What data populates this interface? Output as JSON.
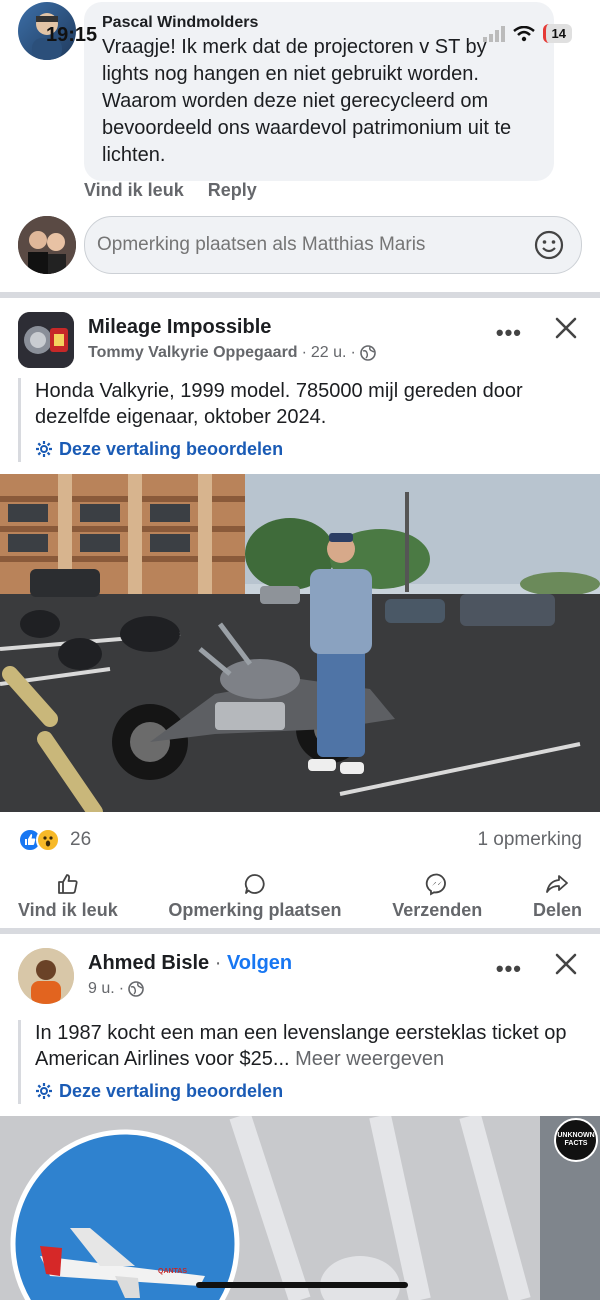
{
  "status_bar": {
    "time": "19:15",
    "battery": "14"
  },
  "comment": {
    "author": "Pascal Windmolders",
    "text": "Vraagje!  Ik merk dat de projectoren v ST by lights nog hangen en niet gebruikt worden. Waarom worden deze niet gerecycleerd om bevoordeeld ons waardevol patrimonium uit te lichten.",
    "like_label": "Vind ik leuk",
    "reply_label": "Reply"
  },
  "reply_box": {
    "placeholder": "Opmerking plaatsen als Matthias Maris"
  },
  "post1": {
    "group": "Mileage Impossible",
    "author": "Tommy Valkyrie Oppegaard",
    "time": "22 u.",
    "text": "Honda Valkyrie, 1999 model. 785000 mijl gereden door dezelfde eigenaar, oktober 2024.",
    "translate_label": "Deze vertaling beoordelen",
    "reaction_count": "26",
    "comment_count": "1 opmerking",
    "actions": {
      "like": "Vind ik leuk",
      "comment": "Opmerking plaatsen",
      "send": "Verzenden",
      "share": "Delen"
    }
  },
  "post2": {
    "author": "Ahmed Bisle",
    "follow_label": "Volgen",
    "time": "9 u.",
    "text": "In 1987 kocht een man een levenslange eersteklas ticket op American Airlines voor $25...",
    "see_more": "Meer weergeven",
    "translate_label": "Deze vertaling beoordelen",
    "badge_text": "UNKNOWN FACTS",
    "plane_text": "QANTAS"
  },
  "colors": {
    "accent": "#1877f2",
    "link": "#1a5bb5",
    "muted": "#65676b",
    "bubble": "#f0f2f5"
  }
}
